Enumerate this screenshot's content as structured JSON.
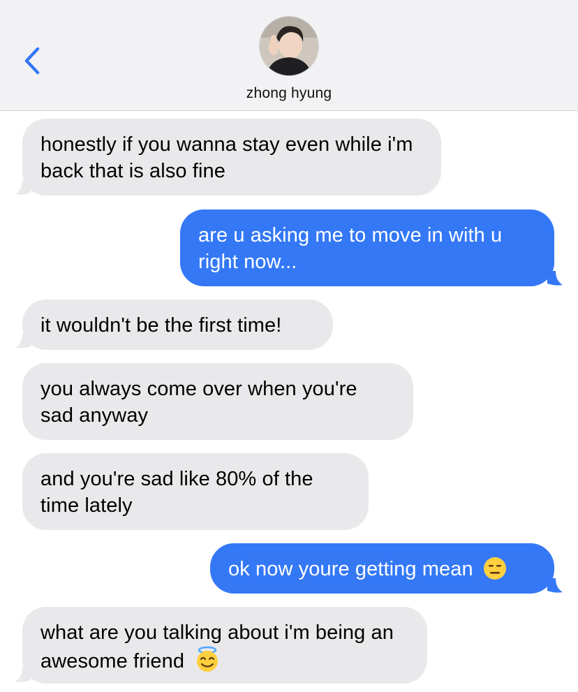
{
  "header": {
    "contact_name": "zhong hyung",
    "back_icon": "chevron-left-icon",
    "accent": "#3478f6"
  },
  "messages": [
    {
      "direction": "incoming",
      "text": "honestly if you wanna stay even while i'm back that is also fine"
    },
    {
      "direction": "outgoing",
      "text": "are u asking me to move in with u right now..."
    },
    {
      "direction": "incoming",
      "text": "it wouldn't be the first time!"
    },
    {
      "direction": "incoming",
      "text": "you always come over when you're sad anyway"
    },
    {
      "direction": "incoming",
      "text": "and you're sad like 80% of the time lately"
    },
    {
      "direction": "outgoing",
      "text": "ok now youre getting mean",
      "emoji": "expressionless-face-icon"
    },
    {
      "direction": "incoming",
      "text": "what are you talking about i'm being an awesome friend",
      "emoji": "smiling-face-with-halo-icon"
    }
  ],
  "colors": {
    "incoming_bubble": "#e9e9eb",
    "outgoing_bubble": "#3478f6"
  }
}
